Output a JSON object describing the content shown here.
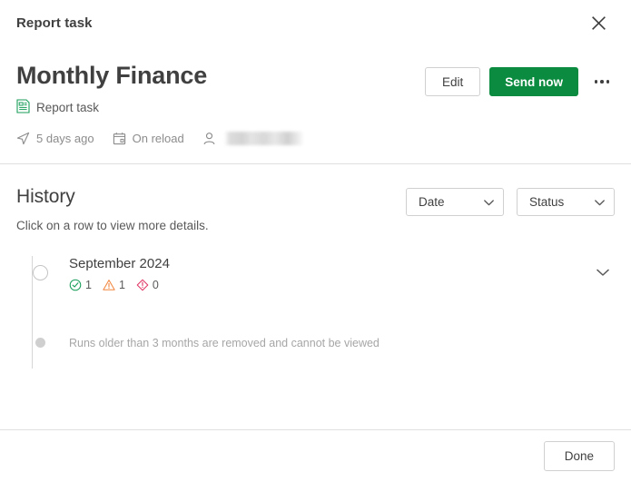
{
  "topbar": {
    "title": "Report task",
    "close_icon": "close-icon"
  },
  "header": {
    "title": "Monthly Finance",
    "subtitle_icon": "report-icon",
    "subtitle": "Report task",
    "meta": [
      {
        "icon": "send-icon",
        "label": "5 days ago"
      },
      {
        "icon": "calendar-icon",
        "label": "On reload"
      },
      {
        "icon": "user-icon",
        "label": ""
      }
    ],
    "actions": {
      "edit_label": "Edit",
      "send_label": "Send now",
      "more_icon": "kebab-menu-icon"
    }
  },
  "history": {
    "title": "History",
    "subtitle": "Click on a row to view more details.",
    "filters": [
      {
        "label": "Date",
        "icon": "chevron-down-icon"
      },
      {
        "label": "Status",
        "icon": "chevron-down-icon"
      }
    ],
    "entries": [
      {
        "title": "September 2024",
        "counts": {
          "success": "1",
          "warning": "1",
          "error": "0"
        },
        "expand_icon": "chevron-down-icon"
      }
    ],
    "retention_note": "Runs older than 3 months are removed and cannot be viewed"
  },
  "footer": {
    "done_label": "Done"
  },
  "colors": {
    "primary_green": "#0a8b3f",
    "success_green": "#1a9e5a",
    "warning_orange": "#f2863f",
    "error_pink": "#e03767",
    "border_gray": "#e0e0e0",
    "text_dark": "#404040",
    "text_muted": "#8c8c8c"
  }
}
